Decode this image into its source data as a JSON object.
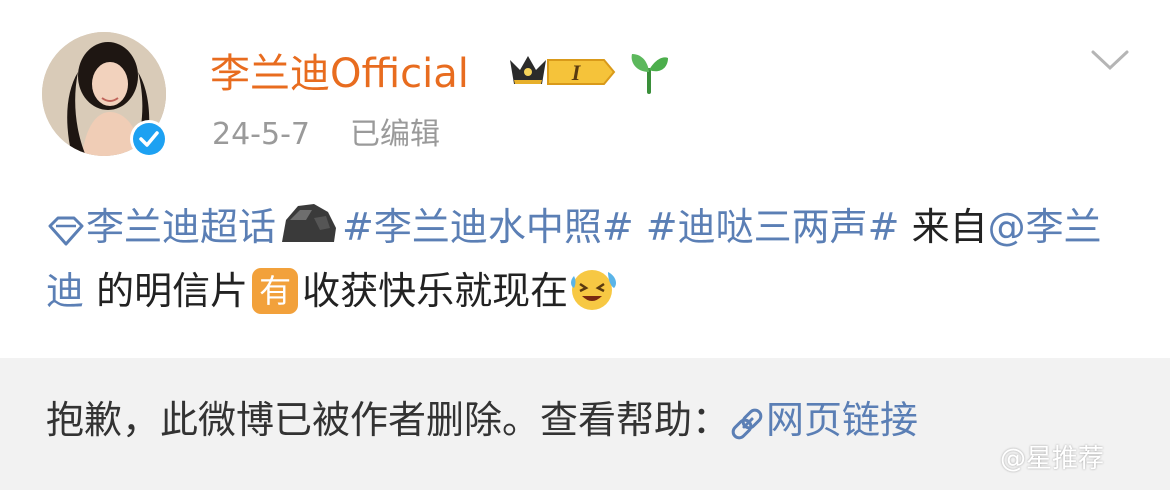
{
  "post": {
    "username": "李兰迪Official",
    "level_badge": "I",
    "date": "24-5-7",
    "edited_label": "已编辑",
    "icons": {
      "verified": "verified-check-icon",
      "crown": "crown-level-icon",
      "sprout": "sprout-icon",
      "menu": "chevron-down-icon",
      "super_topic": "diamond-icon",
      "rock_emoji": "rock-emoji-icon",
      "laugh_emoji": "laugh-cry-emoji-icon",
      "link": "link-icon"
    },
    "content": {
      "super_topic": "李兰迪超话",
      "hashtag1": "#李兰迪水中照#",
      "hashtag2": "#迪哒三两声#",
      "text1": " 来自",
      "mention": "@李兰迪",
      "text2": " 的明信片",
      "you_badge": "有",
      "text3": "收获快乐就现在"
    }
  },
  "deleted_notice": {
    "message": "抱歉，此微博已被作者删除。查看帮助：",
    "link_label": "网页链接"
  },
  "watermark": "@星推荐",
  "colors": {
    "username": "#e86c1f",
    "link": "#5b7fb5",
    "meta": "#9a9a9a",
    "deleted_bg": "#f2f2f2"
  }
}
